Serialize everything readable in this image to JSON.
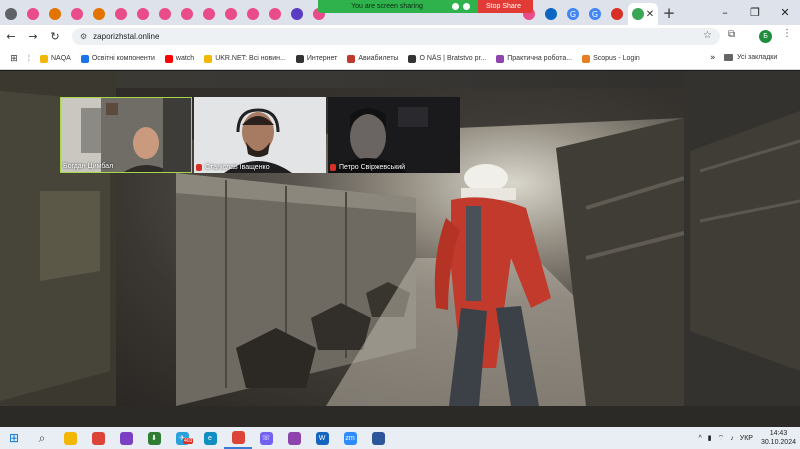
{
  "tabs": [
    {
      "icon": "tab-favicon",
      "color": "#ea4c89",
      "label": ""
    },
    {
      "icon": "tab-favicon",
      "color": "#e37400",
      "label": ""
    },
    {
      "icon": "tab-favicon",
      "color": "#ea4c89",
      "label": ""
    },
    {
      "icon": "tab-favicon",
      "color": "#e37400",
      "label": ""
    },
    {
      "icon": "tab-favicon",
      "color": "#ea4c89",
      "label": ""
    },
    {
      "icon": "tab-favicon",
      "color": "#ea4c89",
      "label": ""
    },
    {
      "icon": "tab-favicon",
      "color": "#ea4c89",
      "label": ""
    },
    {
      "icon": "tab-favicon",
      "color": "#ea4c89",
      "label": ""
    },
    {
      "icon": "tab-favicon",
      "color": "#ea4c89",
      "label": ""
    },
    {
      "icon": "tab-favicon",
      "color": "#ea4c89",
      "label": ""
    },
    {
      "icon": "tab-favicon",
      "color": "#ea4c89",
      "label": ""
    },
    {
      "icon": "tab-favicon",
      "color": "#ea4c89",
      "label": ""
    },
    {
      "icon": "tab-favicon",
      "color": "#5b3cc4",
      "label": ""
    },
    {
      "icon": "tab-favicon",
      "color": "#ea4c89",
      "label": ""
    }
  ],
  "right_tabs": [
    {
      "icon": "tab-favicon",
      "color": "#ea4c89",
      "label": ""
    },
    {
      "icon": "tab-favicon",
      "color": "#0a66c2",
      "label": ""
    },
    {
      "icon": "google-icon",
      "color": "#4285f4",
      "label": "G"
    },
    {
      "icon": "google-icon",
      "color": "#4285f4",
      "label": "G"
    },
    {
      "icon": "tab-favicon",
      "color": "#d93025",
      "label": ""
    }
  ],
  "new_tab_label": "+",
  "window_controls": {
    "minimize": "–",
    "restore": "❐",
    "close": "✕"
  },
  "share_bar": {
    "message": "You are screen sharing",
    "stop": "Stop Share",
    "accent": "#2fb24b",
    "stop_color": "#e23b35"
  },
  "address": {
    "url": "zaporizhstal.online"
  },
  "profile_initial": "Б",
  "bookmarks": [
    {
      "label": "NAQA",
      "color": "#f2b705"
    },
    {
      "label": "Освітні компоненти",
      "color": "#1a73e8"
    },
    {
      "label": "watch",
      "color": "#ff0000"
    },
    {
      "label": "UKR.NET: Всі новин...",
      "color": "#f2b705"
    },
    {
      "label": "Интернет",
      "color": "#333333"
    },
    {
      "label": "Авиабилеты",
      "color": "#c0392b"
    },
    {
      "label": "О NÄS | Bratstvo pr...",
      "color": "#333333"
    },
    {
      "label": "Практична робота...",
      "color": "#8e44ad"
    },
    {
      "label": "Scopus - Login",
      "color": "#e67e22"
    }
  ],
  "bookmarks_more": "»",
  "bookmarks_all": "Усі закладки",
  "participants": [
    {
      "name": "Богдан Цимбал",
      "muted": false,
      "speaking": true
    },
    {
      "name": "Станіслав Іващенко",
      "muted": true,
      "speaking": false
    },
    {
      "name": "Петро Свіржевський",
      "muted": true,
      "speaking": false
    }
  ],
  "taskbar": {
    "apps": [
      {
        "name": "windows-start-icon",
        "color": "#0078d4",
        "label": "⊞"
      },
      {
        "name": "search-icon",
        "color": "#444444",
        "label": "⌕"
      },
      {
        "name": "file-explorer-icon",
        "color": "#f2b705",
        "label": ""
      },
      {
        "name": "chrome-icon",
        "color": "#db4437",
        "label": ""
      },
      {
        "name": "app-icon",
        "color": "#7b3fc4",
        "label": ""
      },
      {
        "name": "download-icon",
        "color": "#2e7d32",
        "label": "⬇"
      },
      {
        "name": "telegram-icon",
        "color": "#2aa1da",
        "label": "✈"
      },
      {
        "name": "edge-icon",
        "color": "#0f8fbf",
        "label": "e"
      },
      {
        "name": "chrome-active-icon",
        "color": "#db4437",
        "label": ""
      },
      {
        "name": "viber-icon",
        "color": "#7360f2",
        "label": "☏"
      },
      {
        "name": "app-icon",
        "color": "#8e44ad",
        "label": ""
      },
      {
        "name": "app-icon",
        "color": "#1565c0",
        "label": "W"
      },
      {
        "name": "zoom-icon",
        "color": "#2d8cff",
        "label": "zm"
      },
      {
        "name": "app-icon",
        "color": "#2b579a",
        "label": ""
      }
    ],
    "telegram_badge": "403",
    "tray": {
      "chevron": "^",
      "lang": "УКР",
      "time": "14:43",
      "date": "30.10.2024"
    }
  }
}
